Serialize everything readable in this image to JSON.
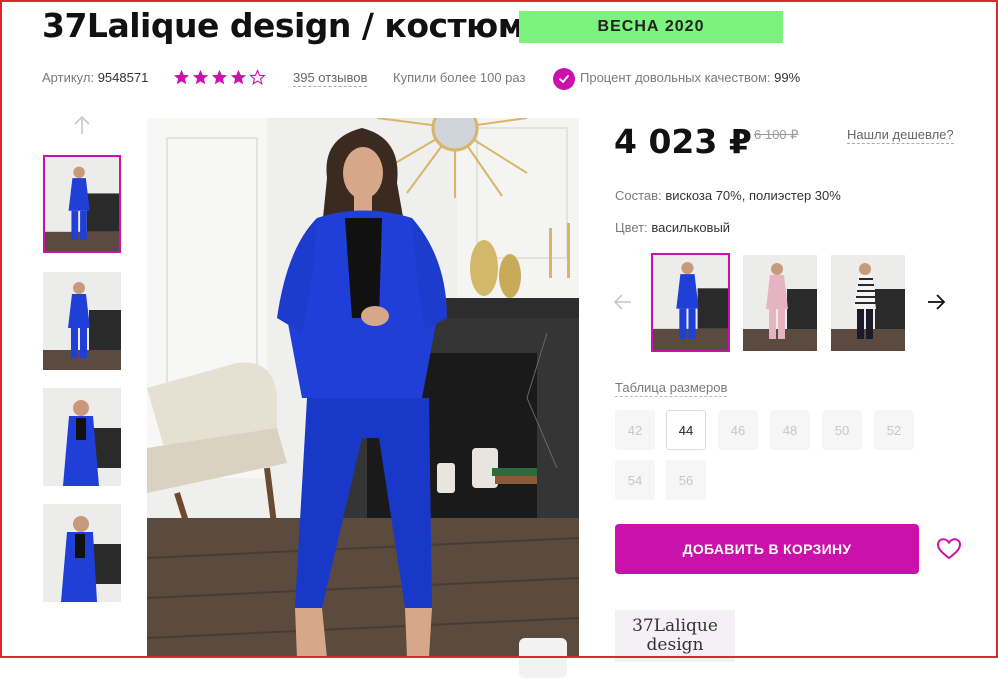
{
  "product": {
    "title": "37Lalique design / костюм",
    "season_badge": "ВЕСНА 2020"
  },
  "meta": {
    "article_label": "Артикул:",
    "article_value": "9548571",
    "rating": 4,
    "rating_max": 5,
    "reviews": "395 отзывов",
    "bought": "Купили более 100 раз",
    "quality_label": "Процент довольных качеством:",
    "quality_value": "99%"
  },
  "price": {
    "current": "4 023 ₽",
    "old": "6 100 ₽",
    "cheaper_link": "Нашли дешевле?"
  },
  "specs": {
    "composition_label": "Состав:",
    "composition_value": "вискоза 70%, полиэстер 30%",
    "color_label": "Цвет:",
    "color_value": "васильковый"
  },
  "color_variants": [
    {
      "name": "васильковый",
      "suit_color": "#1f3fd8",
      "active": true
    },
    {
      "name": "pink",
      "suit_color": "#e6b3c2",
      "active": false
    },
    {
      "name": "striped",
      "suit_color": "#2a2a2a",
      "active": false
    }
  ],
  "sizes": {
    "table_link": "Таблица размеров",
    "items": [
      {
        "label": "42",
        "available": false
      },
      {
        "label": "44",
        "available": true
      },
      {
        "label": "46",
        "available": false
      },
      {
        "label": "48",
        "available": false
      },
      {
        "label": "50",
        "available": false
      },
      {
        "label": "52",
        "available": false
      },
      {
        "label": "54",
        "available": false
      },
      {
        "label": "56",
        "available": false
      }
    ]
  },
  "actions": {
    "add_to_cart": "ДОБАВИТЬ В КОРЗИНУ"
  },
  "brand": {
    "logo_line1": "37Lalique",
    "logo_line2": "design"
  },
  "colors": {
    "accent": "#cb11ab",
    "season_badge_bg": "#7cf37c",
    "star": "#cb11ab",
    "suit_blue": "#1f3fd8",
    "border_red": "#e0262a"
  },
  "icons": {
    "gallery_up": "arrow-up-icon",
    "quality": "check-circle-icon",
    "colors_prev": "arrow-left-icon",
    "colors_next": "arrow-right-icon",
    "favorite": "heart-icon",
    "zoom": "zoom-icon"
  }
}
